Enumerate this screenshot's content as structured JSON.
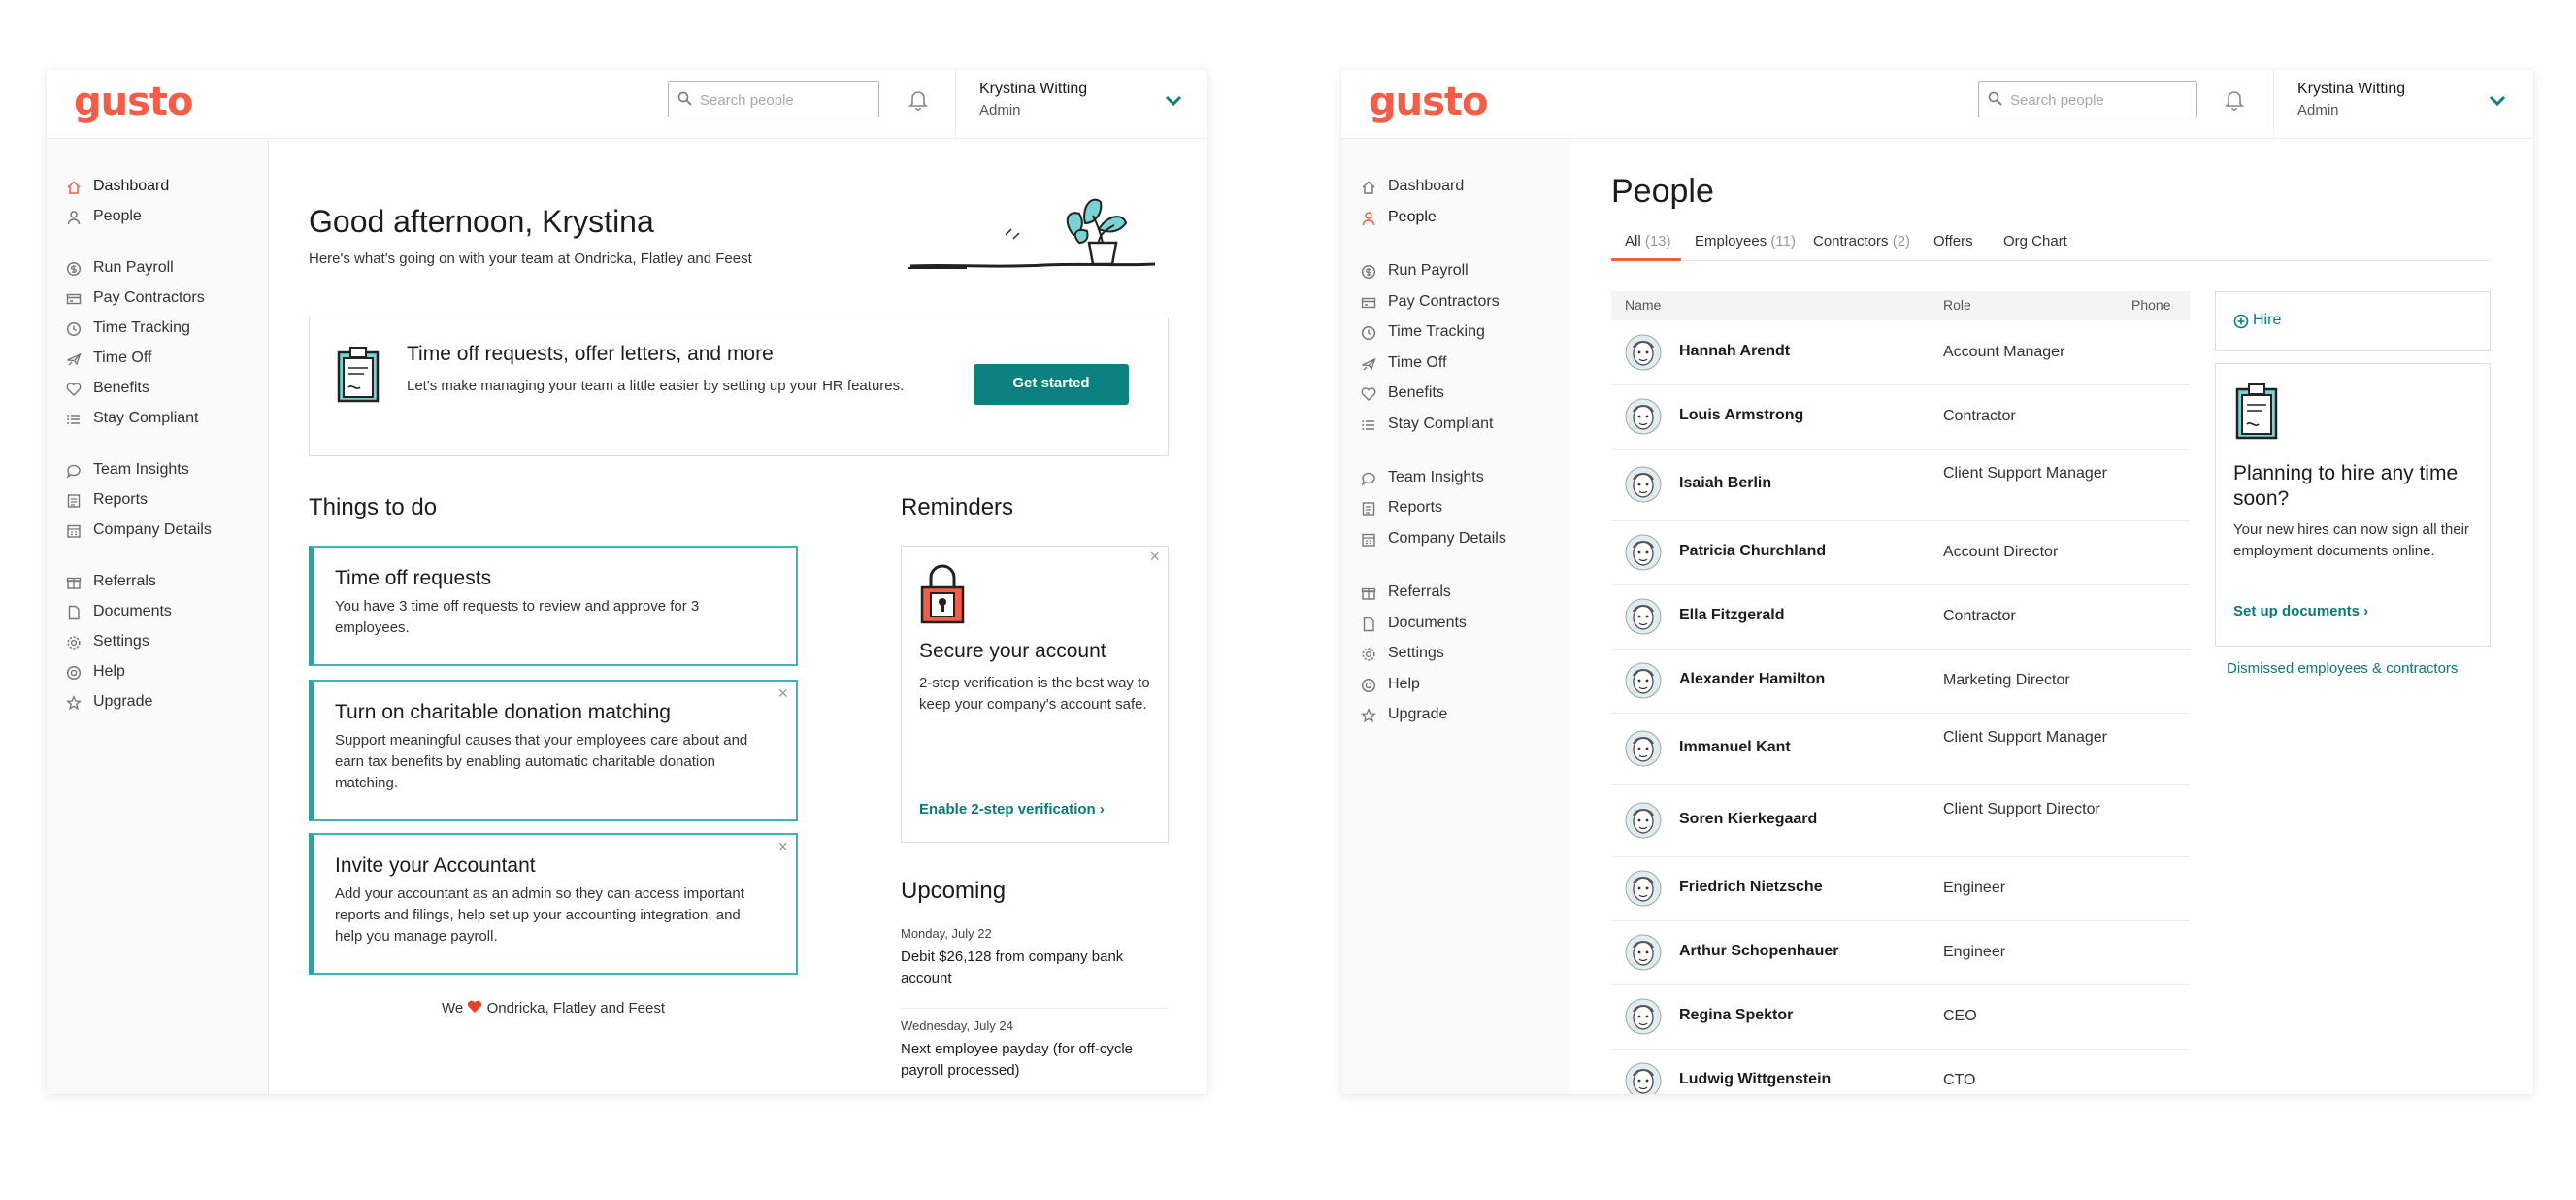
{
  "colors": {
    "brand": "#f45d48",
    "teal": "#0a8080",
    "teal_border": "#40b3b3",
    "red_accent": "#e2432a"
  },
  "dashboard": {
    "logo": "gusto",
    "search": {
      "placeholder": "Search people"
    },
    "user": {
      "name": "Krystina Witting",
      "role": "Admin"
    },
    "nav": [
      {
        "label": "Dashboard",
        "icon": "home-icon"
      },
      {
        "label": "People",
        "icon": "person-icon"
      },
      {
        "label": "Run Payroll",
        "icon": "dollar-icon"
      },
      {
        "label": "Pay Contractors",
        "icon": "card-icon"
      },
      {
        "label": "Time Tracking",
        "icon": "clock-icon"
      },
      {
        "label": "Time Off",
        "icon": "plane-icon"
      },
      {
        "label": "Benefits",
        "icon": "heart-icon"
      },
      {
        "label": "Stay Compliant",
        "icon": "list-icon"
      },
      {
        "label": "Team Insights",
        "icon": "chat-icon"
      },
      {
        "label": "Reports",
        "icon": "report-icon"
      },
      {
        "label": "Company Details",
        "icon": "building-icon"
      },
      {
        "label": "Referrals",
        "icon": "gift-icon"
      },
      {
        "label": "Documents",
        "icon": "document-icon"
      },
      {
        "label": "Settings",
        "icon": "gear-icon"
      },
      {
        "label": "Help",
        "icon": "help-icon"
      },
      {
        "label": "Upgrade",
        "icon": "star-icon"
      }
    ],
    "greeting": "Good afternoon, Krystina",
    "greeting_sub": "Here's what's going on with your team at Ondricka, Flatley and Feest",
    "hr_card": {
      "title": "Time off requests, offer letters, and more",
      "desc": "Let's make managing your team a little easier by setting up your HR features.",
      "button": "Get started"
    },
    "things_title": "Things to do",
    "todos": [
      {
        "title": "Time off requests",
        "desc": "You have 3 time off requests to review and approve for 3 employees."
      },
      {
        "title": "Turn on charitable donation matching",
        "desc": "Support meaningful causes that your employees care about and earn tax benefits by enabling automatic charitable donation matching."
      },
      {
        "title": "Invite your Accountant",
        "desc": "Add your accountant as an admin so they can access important reports and filings, help set up your accounting integration, and help you manage payroll."
      }
    ],
    "close_glyph": "×",
    "footer_prefix": "We",
    "footer_company": "Ondricka, Flatley and Feest",
    "reminders_title": "Reminders",
    "reminder": {
      "title": "Secure your account",
      "desc": "2-step verification is the best way to keep your company's account safe.",
      "link": "Enable 2-step verification ›"
    },
    "upcoming_title": "Upcoming",
    "upcoming": [
      {
        "date": "Monday, July 22",
        "text": "Debit $26,128 from company bank account"
      },
      {
        "date": "Wednesday, July 24",
        "text": "Next employee payday (for off-cycle payroll processed)"
      }
    ]
  },
  "people_page": {
    "logo": "gusto",
    "search": {
      "placeholder": "Search people"
    },
    "user": {
      "name": "Krystina Witting",
      "role": "Admin"
    },
    "title": "People",
    "tabs": [
      {
        "label": "All",
        "count": "(13)"
      },
      {
        "label": "Employees",
        "count": "(11)"
      },
      {
        "label": "Contractors",
        "count": "(2)"
      },
      {
        "label": "Offers",
        "count": ""
      },
      {
        "label": "Org Chart",
        "count": ""
      }
    ],
    "columns": [
      "Name",
      "Role",
      "Phone"
    ],
    "rows": [
      {
        "name": "Hannah Arendt",
        "role": "Account Manager"
      },
      {
        "name": "Louis Armstrong",
        "role": "Contractor"
      },
      {
        "name": "Isaiah Berlin",
        "role": "Client Support Manager"
      },
      {
        "name": "Patricia Churchland",
        "role": "Account Director"
      },
      {
        "name": "Ella Fitzgerald",
        "role": "Contractor"
      },
      {
        "name": "Alexander Hamilton",
        "role": "Marketing Director"
      },
      {
        "name": "Immanuel Kant",
        "role": "Client Support Manager"
      },
      {
        "name": "Soren Kierkegaard",
        "role": "Client Support Director"
      },
      {
        "name": "Friedrich Nietzsche",
        "role": "Engineer"
      },
      {
        "name": "Arthur Schopenhauer",
        "role": "Engineer"
      },
      {
        "name": "Regina Spektor",
        "role": "CEO"
      },
      {
        "name": "Ludwig Wittgenstein",
        "role": "CTO"
      }
    ],
    "hire_label": "Hire",
    "hire_card": {
      "title": "Planning to hire any time soon?",
      "desc": "Your new hires can now sign all their employment documents online.",
      "link": "Set up documents ›"
    },
    "dismissed_link": "Dismissed employees & contractors"
  }
}
